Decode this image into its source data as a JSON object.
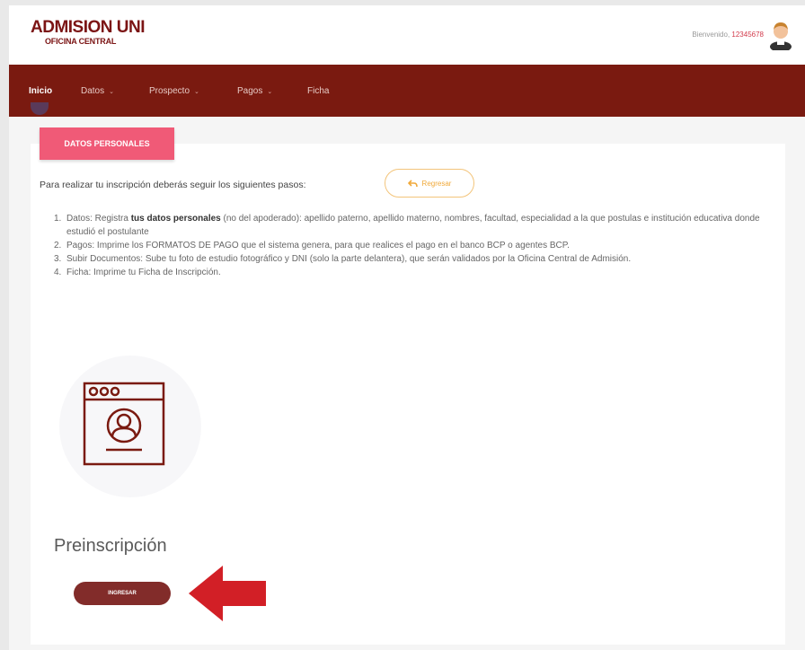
{
  "header": {
    "logo_main": "ADMISION UNI",
    "logo_sub": "OFICINA CENTRAL",
    "welcome_label": "Bienvenido,",
    "user_id": "12345678"
  },
  "nav": {
    "items": [
      {
        "label": "Inicio",
        "active": true
      },
      {
        "label": "Datos"
      },
      {
        "label": "Prospecto"
      },
      {
        "label": "Pagos"
      },
      {
        "label": "Ficha"
      }
    ],
    "caret": "⌄"
  },
  "card": {
    "badge": "DATOS PERSONALES",
    "intro": "Para realizar tu inscripción deberás seguir los siguientes pasos:",
    "back_button": "Regresar",
    "steps": [
      {
        "num": "1.",
        "pre": "Datos: Registra ",
        "bold": "tus datos personales",
        "post": " (no del apoderado): apellido paterno, apellido materno, nombres, facultad, especialidad a la que postulas e institución educativa donde estudió el postulante"
      },
      {
        "num": "2.",
        "pre": "Pagos: Imprime los FORMATOS DE PAGO que el sistema genera, para que realices el pago en el banco BCP o agentes BCP.",
        "bold": "",
        "post": ""
      },
      {
        "num": "3.",
        "pre": "Subir Documentos: Sube tu foto de estudio fotográfico y DNI (solo la parte delantera), que serán validados por la Oficina Central de Admisión.",
        "bold": "",
        "post": ""
      },
      {
        "num": "4.",
        "pre": "Ficha: Imprime tu Ficha de Inscripción.",
        "bold": "",
        "post": ""
      }
    ],
    "section_title": "Preinscripción",
    "ingresar_button": "INGRESAR"
  },
  "colors": {
    "brand": "#7a1a10",
    "badge": "#f05a77",
    "accent_orange": "#f0a93a",
    "arrow": "#d21f26"
  },
  "icons": [
    "user-avatar-icon",
    "reply-arrow-icon",
    "profile-window-icon",
    "red-pointer-arrow-icon"
  ]
}
